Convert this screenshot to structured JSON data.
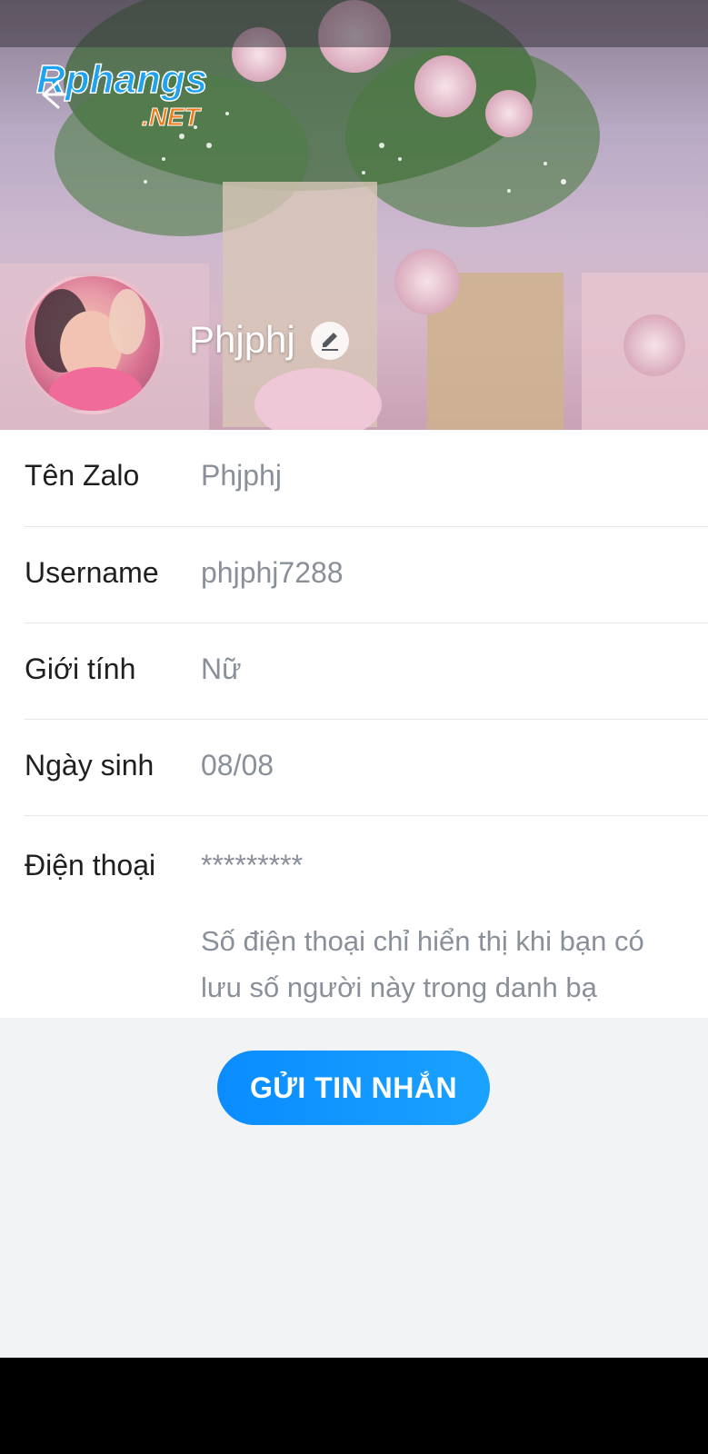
{
  "header": {
    "watermark_text": "Rphangs.NET",
    "display_name": "Phjphj"
  },
  "profile_rows": [
    {
      "label": "Tên Zalo",
      "value": "Phjphj"
    },
    {
      "label": "Username",
      "value": "phjphj7288"
    },
    {
      "label": "Giới tính",
      "value": "Nữ"
    },
    {
      "label": "Ngày sinh",
      "value": "08/08"
    },
    {
      "label": "Điện thoại",
      "value": "*********"
    }
  ],
  "phone_note": "Số điện thoại chỉ hiển thị khi bạn có lưu số người này trong danh bạ",
  "actions": {
    "send_message_label": "GỬI TIN NHẮN"
  },
  "colors": {
    "accent": "#0a8cff",
    "value_text": "#8a9099",
    "label_text": "#1f1f1f",
    "page_bg": "#f2f3f5"
  },
  "icons": {
    "back": "arrow-left-icon",
    "edit": "pencil-icon"
  }
}
